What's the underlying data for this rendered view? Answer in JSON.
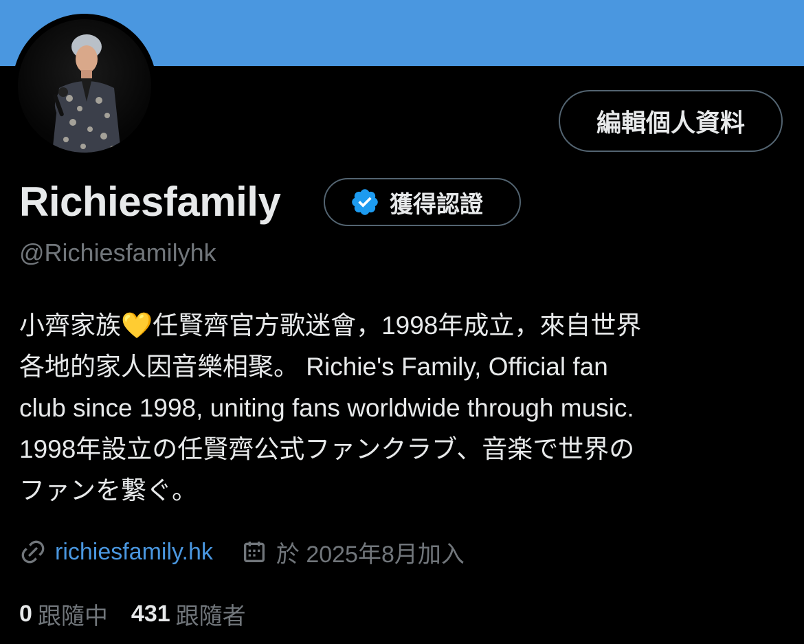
{
  "profile": {
    "display_name": "Richiesfamily",
    "handle": "@Richiesfamilyhk",
    "edit_button": "編輯個人資料",
    "verified_label": "獲得認證",
    "bio_lines": [
      "小齊家族💛任賢齊官方歌迷會，1998年成立，來自世界",
      "各地的家人因音樂相聚。 Richie's Family, Official fan",
      "club since 1998, uniting fans worldwide through music.",
      "1998年設立の任賢齊公式ファンクラブ、音楽で世界の",
      "ファンを繋ぐ。"
    ],
    "website": "richiesfamily.hk",
    "joined": "於 2025年8月加入",
    "following_count": "0",
    "following_label": "跟隨中",
    "followers_count": "431",
    "followers_label": "跟隨者"
  },
  "icons": {
    "verified": "verified-badge-icon",
    "link": "link-icon",
    "calendar": "calendar-icon"
  },
  "colors": {
    "banner": "#4a97e0",
    "background": "#000000",
    "text_primary": "#e7e9ea",
    "text_secondary": "#71767b",
    "link": "#4a97e0",
    "verified": "#1d9bf0",
    "border": "#536471"
  }
}
